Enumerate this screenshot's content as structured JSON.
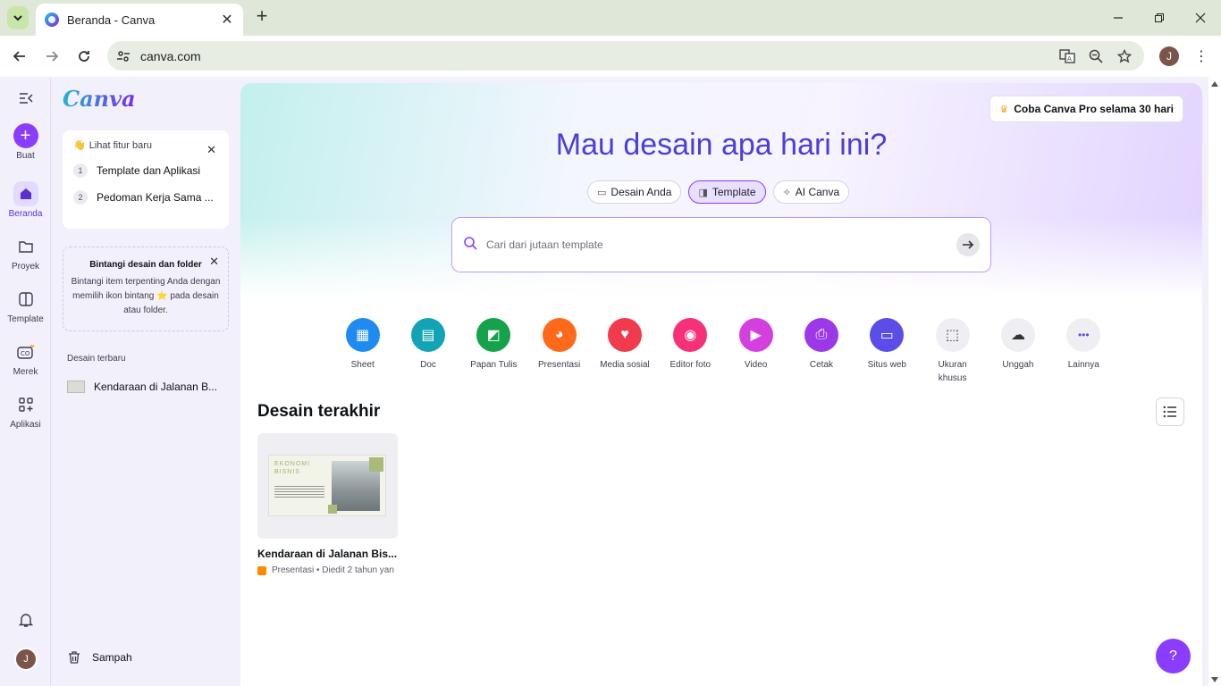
{
  "browser": {
    "tab_title": "Beranda - Canva",
    "url": "canva.com",
    "profile_initial": "J"
  },
  "rail": {
    "items": [
      {
        "label": "Buat",
        "icon": "plus-icon"
      },
      {
        "label": "Beranda",
        "icon": "home-icon"
      },
      {
        "label": "Proyek",
        "icon": "folder-icon"
      },
      {
        "label": "Template",
        "icon": "template-icon"
      },
      {
        "label": "Merek",
        "icon": "brand-icon"
      },
      {
        "label": "Aplikasi",
        "icon": "apps-icon"
      }
    ],
    "user_initial": "J"
  },
  "panel": {
    "logo": "Canva",
    "new_features": {
      "header": "Lihat fitur baru",
      "items": [
        {
          "num": "1",
          "label": "Template dan Aplikasi"
        },
        {
          "num": "2",
          "label": "Pedoman Kerja Sama ..."
        }
      ]
    },
    "star_tip": {
      "title": "Bintangi desain dan folder",
      "body": "Bintangi item terpenting Anda dengan memilih ikon bintang ⭐ pada desain atau folder."
    },
    "recent_label": "Desain terbaru",
    "recent_item": "Kendaraan di Jalanan B...",
    "trash": "Sampah"
  },
  "main": {
    "pro_button": "Coba Canva Pro selama 30 hari",
    "headline": "Mau desain apa hari ini?",
    "chips": [
      {
        "label": "Desain Anda",
        "icon": "folder-icon",
        "active": false
      },
      {
        "label": "Template",
        "icon": "template-icon",
        "active": true
      },
      {
        "label": "AI Canva",
        "icon": "sparkle-icon",
        "active": false
      }
    ],
    "search_placeholder": "Cari dari jutaan template",
    "shortcuts": [
      {
        "label": "Sheet",
        "color": "#1f8bf0",
        "glyph": "▦"
      },
      {
        "label": "Doc",
        "color": "#13a3b5",
        "glyph": "▤"
      },
      {
        "label": "Papan Tulis",
        "color": "#14a24a",
        "glyph": "◩"
      },
      {
        "label": "Presentasi",
        "color": "#ff6a1a",
        "glyph": "◕"
      },
      {
        "label": "Media sosial",
        "color": "#f23a4d",
        "glyph": "♥"
      },
      {
        "label": "Editor foto",
        "color": "#f7307a",
        "glyph": "◉"
      },
      {
        "label": "Video",
        "color": "#d43fe0",
        "glyph": "▶"
      },
      {
        "label": "Cetak",
        "color": "#9b38e8",
        "glyph": "⎙"
      },
      {
        "label": "Situs web",
        "color": "#5b4de8",
        "glyph": "▭"
      },
      {
        "label": "Ukuran khusus",
        "color": "#efeff3",
        "glyph": "⬚"
      },
      {
        "label": "Unggah",
        "color": "#efeff3",
        "glyph": "☁"
      },
      {
        "label": "Lainnya",
        "color": "#efeff3",
        "glyph": "•••"
      }
    ],
    "recent_title": "Desain terakhir",
    "design": {
      "thumb_title": "EKONOMI BISNIS",
      "name": "Kendaraan di Jalanan Bis...",
      "meta": "Presentasi • Diedit 2 tahun yan"
    },
    "help": "?"
  }
}
